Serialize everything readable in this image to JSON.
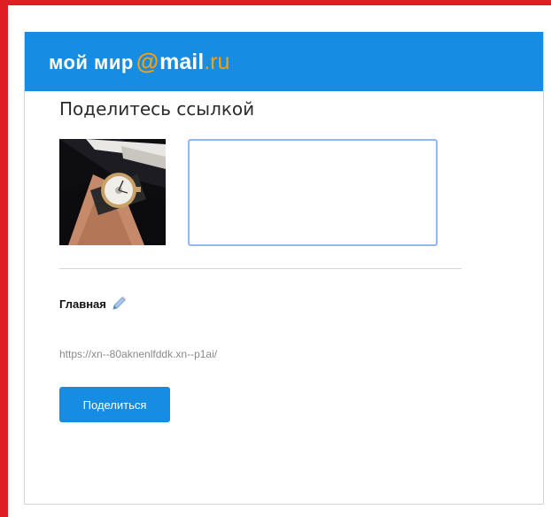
{
  "header": {
    "logo": {
      "moy_mir": "мой мир",
      "at": "@",
      "mail": "mail",
      "ru": ".ru"
    }
  },
  "share": {
    "title": "Поделитесь ссылкой",
    "comment_value": "",
    "section_label": "Главная",
    "url": "https://xn--80aknenlfddk.xn--p1ai/",
    "button_label": "Поделиться"
  },
  "colors": {
    "header_bg": "#168de2",
    "logo_accent": "#ff9e00",
    "button_bg": "#168de2",
    "frame_red": "#e11d24"
  },
  "icons": {
    "edit": "pencil-icon"
  }
}
